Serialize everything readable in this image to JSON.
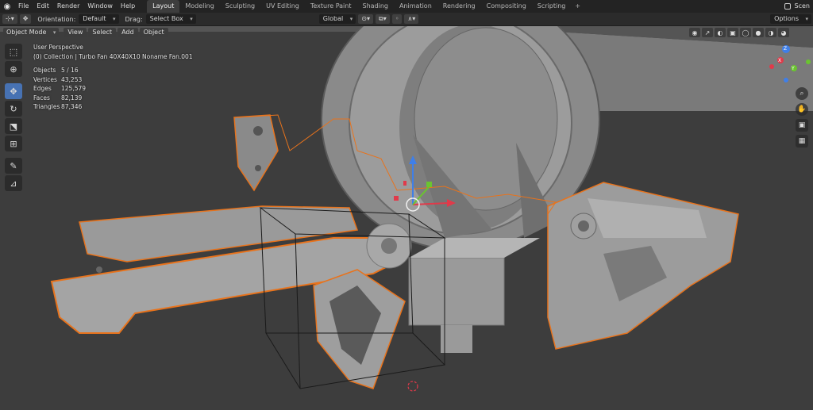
{
  "menubar": {
    "items": [
      "File",
      "Edit",
      "Render",
      "Window",
      "Help"
    ],
    "workspaces": [
      "Layout",
      "Modeling",
      "Sculpting",
      "UV Editing",
      "Texture Paint",
      "Shading",
      "Animation",
      "Rendering",
      "Compositing",
      "Scripting"
    ],
    "active_workspace": "Layout",
    "add_tab": "+",
    "scene": "Scen"
  },
  "toolheader": {
    "orientation_label": "Orientation:",
    "orientation_value": "Default",
    "drag_label": "Drag:",
    "drag_value": "Select Box",
    "transform_orientation": "Global",
    "options": "Options"
  },
  "viewport_header": {
    "mode": "Object Mode",
    "menus": [
      "View",
      "Select",
      "Add",
      "Object"
    ]
  },
  "overlay": {
    "view_name": "User Perspective",
    "collection_info": "(0) Collection | Turbo Fan 40X40X10 Noname Fan.001",
    "stats": [
      {
        "key": "Objects",
        "value": "5 / 16"
      },
      {
        "key": "Vertices",
        "value": "43,253"
      },
      {
        "key": "Edges",
        "value": "125,579"
      },
      {
        "key": "Faces",
        "value": "82,139"
      },
      {
        "key": "Triangles",
        "value": "87,346"
      }
    ]
  },
  "gizmo": {
    "x": "X",
    "y": "Y",
    "z": "Z"
  },
  "colors": {
    "accent": "#4772b3",
    "selection_outline": "#e8731c",
    "active_workspace_bg": "#3d3d3d",
    "menubar_bg": "#232323"
  },
  "icons": {
    "toolbar": [
      "cursor-select-icon",
      "3d-cursor-icon",
      "move-icon",
      "rotate-icon",
      "scale-icon",
      "transform-icon",
      "annotate-icon",
      "measure-icon"
    ],
    "navigation": [
      "zoom-icon",
      "pan-hand-icon",
      "camera-icon",
      "grid-icon"
    ]
  }
}
